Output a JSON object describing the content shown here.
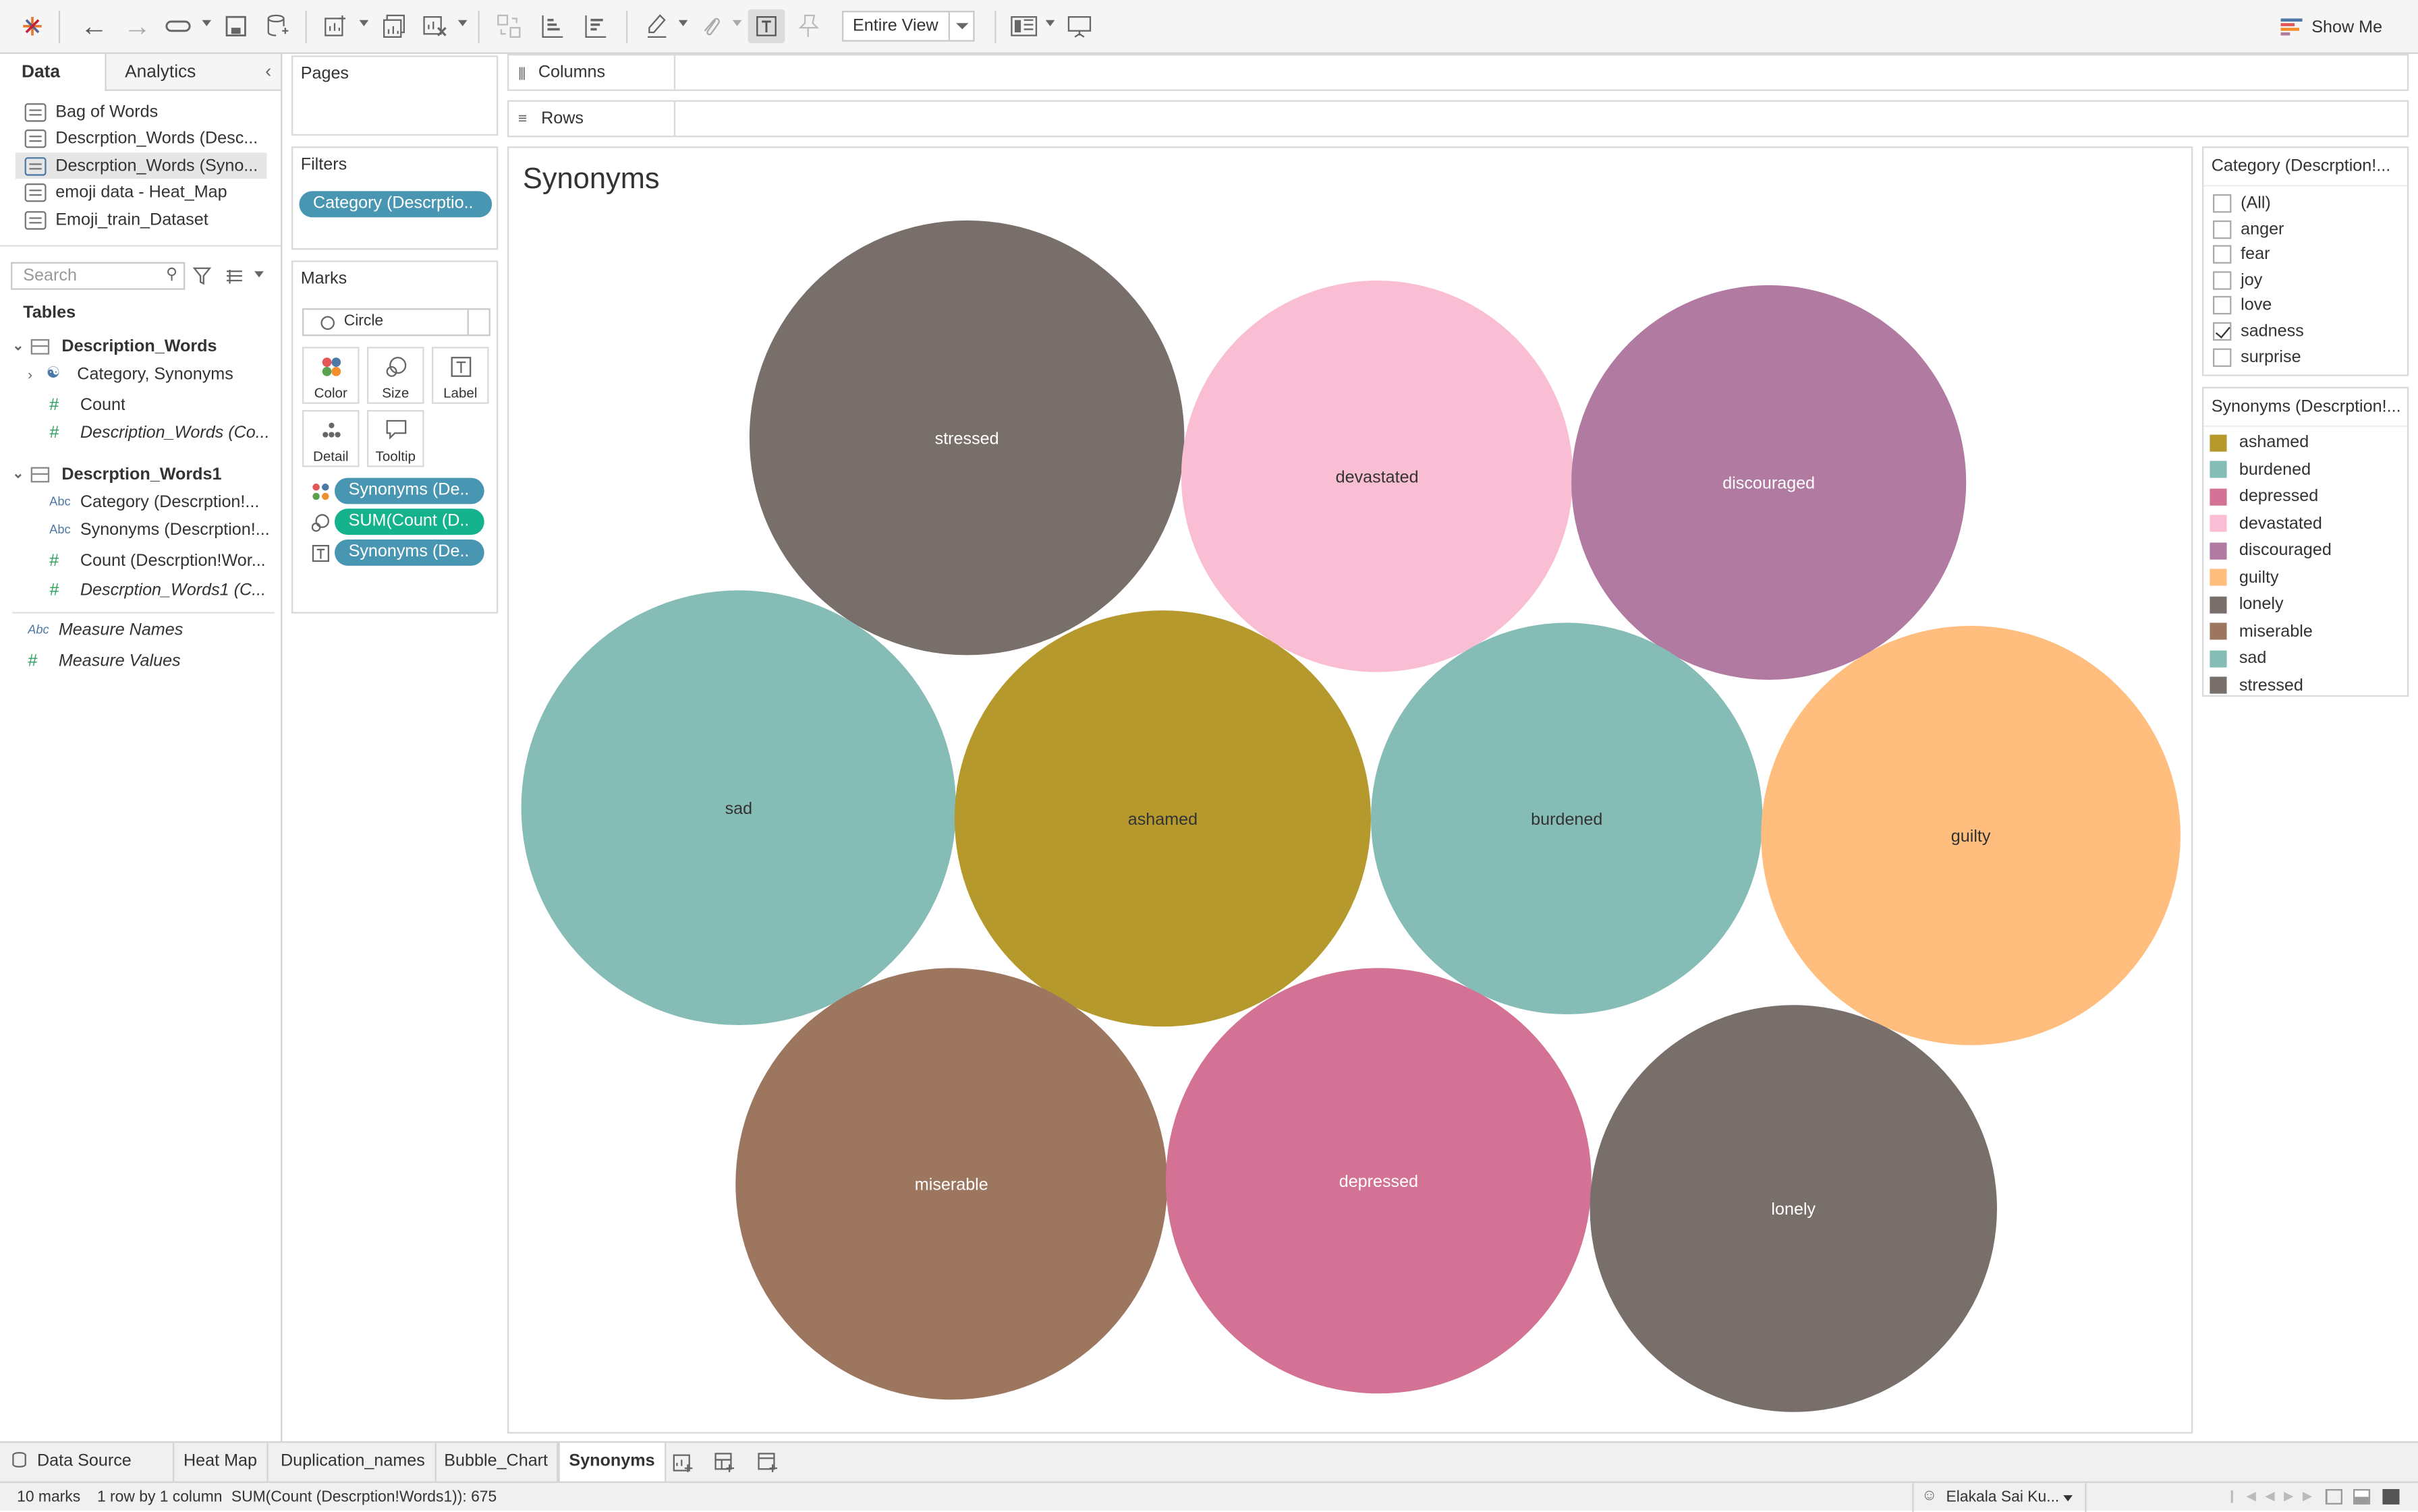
{
  "toolbar": {
    "view_mode": "Entire View",
    "show_me_label": "Show Me"
  },
  "left_pane": {
    "tabs": [
      "Data",
      "Analytics"
    ],
    "data_sources": [
      {
        "label": "Bag of Words",
        "selected": false
      },
      {
        "label": "Descrption_Words (Desc...",
        "selected": false
      },
      {
        "label": "Descrption_Words (Syno...",
        "selected": true
      },
      {
        "label": "emoji data - Heat_Map",
        "selected": false
      },
      {
        "label": "Emoji_train_Dataset",
        "selected": false
      }
    ],
    "search_placeholder": "Search",
    "tables_label": "Tables",
    "table1": {
      "name": "Description_Words",
      "fields": [
        {
          "label": "Category, Synonyms",
          "type": "hierarchy"
        },
        {
          "label": "Count",
          "type": "#"
        },
        {
          "label": "Description_Words (Co...",
          "type": "#"
        }
      ]
    },
    "table2": {
      "name": "Descrption_Words1",
      "fields": [
        {
          "label": "Category (Descrption!...",
          "type": "Abc"
        },
        {
          "label": "Synonyms (Descrption!...",
          "type": "Abc"
        },
        {
          "label": "Count (Descrption!Wor...",
          "type": "#"
        },
        {
          "label": "Descrption_Words1 (C...",
          "type": "#"
        }
      ]
    },
    "measure_names": "Measure Names",
    "measure_values": "Measure Values",
    "type_abc": "Abc",
    "type_num": "#"
  },
  "shelves": {
    "pages": "Pages",
    "columns": "Columns",
    "rows": "Rows",
    "filters": "Filters",
    "filter_pill": "Category (Descrptio..",
    "marks": "Marks",
    "mark_type": "Circle",
    "mark_buttons": [
      "Color",
      "Size",
      "Label",
      "Detail",
      "Tooltip"
    ],
    "mark_pills": [
      "Synonyms (De..",
      "SUM(Count (D..",
      "Synonyms (De.."
    ]
  },
  "sheet": {
    "title": "Synonyms"
  },
  "chart_data": {
    "type": "bubble",
    "title": "Synonyms",
    "bubbles": [
      {
        "label": "stressed",
        "color": "#796f6a",
        "text_color": "#ffffff"
      },
      {
        "label": "devastated",
        "color": "#f9bed3",
        "text_color": "#333333"
      },
      {
        "label": "discouraged",
        "color": "#b07aa1",
        "text_color": "#ffffff"
      },
      {
        "label": "sad",
        "color": "#86bcb6",
        "text_color": "#333333"
      },
      {
        "label": "ashamed",
        "color": "#b6992d",
        "text_color": "#333333"
      },
      {
        "label": "burdened",
        "color": "#86bcb6",
        "text_color": "#333333"
      },
      {
        "label": "guilty",
        "color": "#ffbe7d",
        "text_color": "#333333"
      },
      {
        "label": "miserable",
        "color": "#9d7660",
        "text_color": "#ffffff"
      },
      {
        "label": "depressed",
        "color": "#d37295",
        "text_color": "#ffffff"
      },
      {
        "label": "lonely",
        "color": "#796f6a",
        "text_color": "#ffffff"
      }
    ]
  },
  "filter_card": {
    "title": "Category (Descrption!...",
    "options": [
      {
        "label": "(All)",
        "checked": false
      },
      {
        "label": "anger",
        "checked": false
      },
      {
        "label": "fear",
        "checked": false
      },
      {
        "label": "joy",
        "checked": false
      },
      {
        "label": "love",
        "checked": false
      },
      {
        "label": "sadness",
        "checked": true
      },
      {
        "label": "surprise",
        "checked": false
      }
    ]
  },
  "legend_card": {
    "title": "Synonyms (Descrption!...",
    "items": [
      {
        "label": "ashamed",
        "color": "#b6992d"
      },
      {
        "label": "burdened",
        "color": "#86bcb6"
      },
      {
        "label": "depressed",
        "color": "#d37295"
      },
      {
        "label": "devastated",
        "color": "#f9bed3"
      },
      {
        "label": "discouraged",
        "color": "#b07aa1"
      },
      {
        "label": "guilty",
        "color": "#ffbe7d"
      },
      {
        "label": "lonely",
        "color": "#796f6a"
      },
      {
        "label": "miserable",
        "color": "#9d7660"
      },
      {
        "label": "sad",
        "color": "#86bcb6"
      },
      {
        "label": "stressed",
        "color": "#796f6a"
      }
    ]
  },
  "sheet_tabs": {
    "data_source": "Data Source",
    "tabs": [
      {
        "label": "Heat Map",
        "active": false
      },
      {
        "label": "Duplication_names",
        "active": false
      },
      {
        "label": "Bubble_Chart",
        "active": false
      },
      {
        "label": "Synonyms",
        "active": true
      }
    ]
  },
  "status": {
    "marks": "10 marks",
    "dims": "1 row by 1 column",
    "sum": "SUM(Count (Descrption!Words1)): 675",
    "user": "Elakala Sai Ku..."
  }
}
